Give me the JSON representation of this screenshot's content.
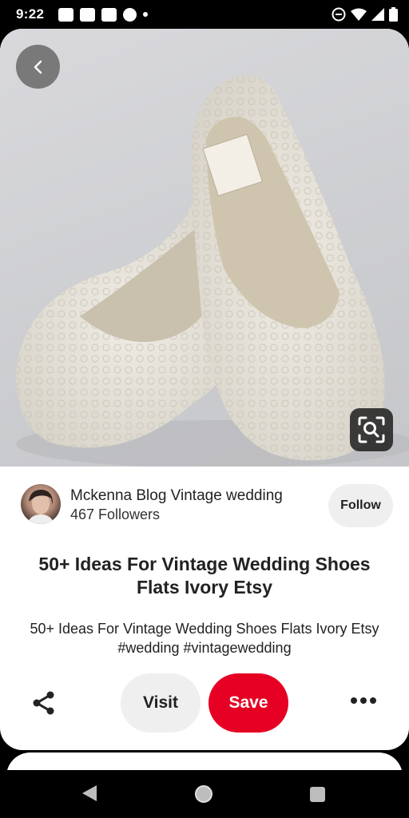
{
  "status_bar": {
    "time": "9:22"
  },
  "pin": {
    "author_name": "Mckenna Blog Vintage wedding",
    "followers": "467 Followers",
    "follow_label": "Follow",
    "title": "50+  Ideas For Vintage Wedding Shoes Flats Ivory Etsy",
    "description": "50+  Ideas For Vintage Wedding Shoes Flats Ivory Etsy #wedding #vintagewedding"
  },
  "actions": {
    "visit_label": "Visit",
    "save_label": "Save"
  },
  "colors": {
    "save_button": "#e60023",
    "pill_button": "#efefef"
  }
}
